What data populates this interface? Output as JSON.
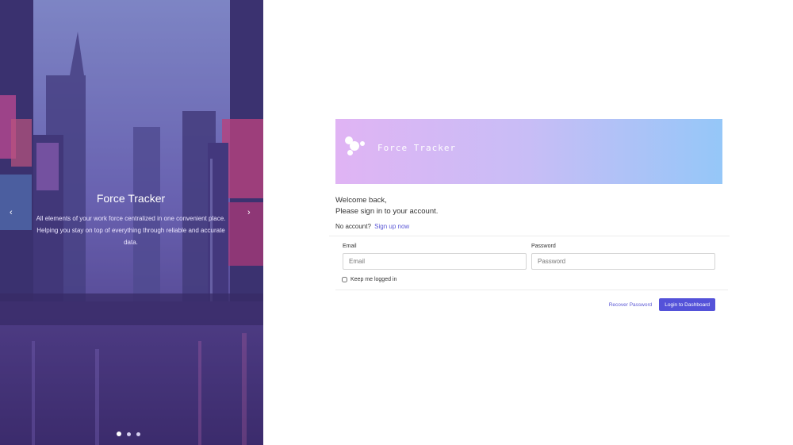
{
  "hero": {
    "title": "Force Tracker",
    "description": "All elements of your work force centralized in one convenient place. Helping you stay on top of everything through reliable and accurate data.",
    "prev_icon": "chevron-left-icon",
    "next_icon": "chevron-right-icon",
    "slides_total": 3,
    "active_slide": 1
  },
  "login": {
    "brand": "Force Tracker",
    "logo_icon": "bubbles-logo-icon",
    "welcome_line1": "Welcome back,",
    "welcome_line2": "Please sign in to your account.",
    "no_account_text": "No account?",
    "signup_link": "Sign up now",
    "email_label": "Email",
    "email_placeholder": "Email",
    "email_value": "",
    "password_label": "Password",
    "password_placeholder": "Password",
    "password_value": "",
    "remember_label": "Keep me logged in",
    "remember_checked": false,
    "recover_link": "Recover Password",
    "login_button": "Login to Dashboard"
  },
  "colors": {
    "accent": "#5452d9",
    "banner_start": "#e0b4f4",
    "banner_end": "#95c7f8",
    "hero_overlay": "#5b46a0"
  }
}
